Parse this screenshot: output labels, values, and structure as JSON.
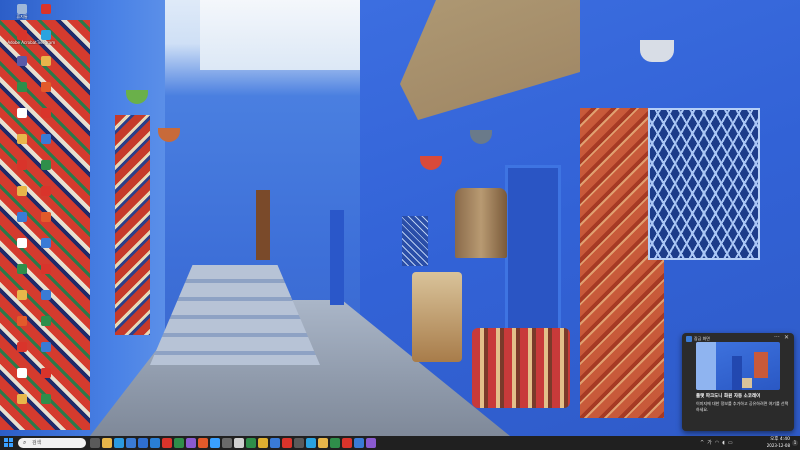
{
  "desktop": {
    "icons": [
      {
        "label": "휴지통",
        "icon": "recycle-bin-icon",
        "color": "#9fb7d8"
      },
      {
        "label": "",
        "icon": "app-icon",
        "color": "#d9342b"
      },
      {
        "label": "Adobe Acrobat",
        "icon": "acrobat-icon",
        "color": "#d9342b"
      },
      {
        "label": "Telegram",
        "icon": "telegram-icon",
        "color": "#2aa3e0"
      },
      {
        "label": "",
        "icon": "app-icon",
        "color": "#5a5aa8"
      },
      {
        "label": "",
        "icon": "folder-icon",
        "color": "#e8b64a"
      },
      {
        "label": "",
        "icon": "app-icon",
        "color": "#2f8e4a"
      },
      {
        "label": "",
        "icon": "app-icon",
        "color": "#e25a2a"
      },
      {
        "label": "",
        "icon": "app-icon",
        "color": "#ffffff"
      },
      {
        "label": "",
        "icon": "app-icon",
        "color": "#d9342b"
      },
      {
        "label": "",
        "icon": "folder-icon",
        "color": "#e8b64a"
      },
      {
        "label": "",
        "icon": "app-icon",
        "color": "#3a7bd5"
      },
      {
        "label": "",
        "icon": "app-icon",
        "color": "#d9342b"
      },
      {
        "label": "",
        "icon": "app-icon",
        "color": "#2f8e4a"
      },
      {
        "label": "",
        "icon": "folder-icon",
        "color": "#e8b64a"
      },
      {
        "label": "",
        "icon": "app-icon",
        "color": "#d9342b"
      },
      {
        "label": "",
        "icon": "app-icon",
        "color": "#3a7bd5"
      },
      {
        "label": "",
        "icon": "app-icon",
        "color": "#e25a2a"
      },
      {
        "label": "",
        "icon": "app-icon",
        "color": "#ffffff"
      },
      {
        "label": "",
        "icon": "app-icon",
        "color": "#3a7bd5"
      },
      {
        "label": "",
        "icon": "app-icon",
        "color": "#2f8e4a"
      },
      {
        "label": "",
        "icon": "app-icon",
        "color": "#d9342b"
      },
      {
        "label": "",
        "icon": "folder-icon",
        "color": "#e8b64a"
      },
      {
        "label": "",
        "icon": "app-icon",
        "color": "#3a7bd5"
      },
      {
        "label": "",
        "icon": "app-icon",
        "color": "#e25a2a"
      },
      {
        "label": "",
        "icon": "app-icon",
        "color": "#2f8e4a"
      },
      {
        "label": "",
        "icon": "app-icon",
        "color": "#d9342b"
      },
      {
        "label": "",
        "icon": "app-icon",
        "color": "#3a7bd5"
      },
      {
        "label": "",
        "icon": "app-icon",
        "color": "#ffffff"
      },
      {
        "label": "",
        "icon": "app-icon",
        "color": "#d9342b"
      },
      {
        "label": "",
        "icon": "folder-icon",
        "color": "#e8b64a"
      },
      {
        "label": "",
        "icon": "app-icon",
        "color": "#2f8e4a"
      }
    ]
  },
  "toast": {
    "app_name": "잠금 화면",
    "more_glyph": "···",
    "close_glyph": "✕",
    "title": "플랫 파크도니 화원 자동 소코레이",
    "body": "이미지에 대한 정보를 추가하고 공유하려면 여기를 선택하세요."
  },
  "taskbar": {
    "search_placeholder": "검색",
    "search_glyph": "⌕",
    "apps": [
      {
        "icon": "task-view-icon",
        "color": "#5a5a5a"
      },
      {
        "icon": "file-explorer-icon",
        "color": "#e8b64a"
      },
      {
        "icon": "edge-icon",
        "color": "#2b9ae0"
      },
      {
        "icon": "store-icon",
        "color": "#3a7bd5"
      },
      {
        "icon": "mail-icon",
        "color": "#2f6fd0"
      },
      {
        "icon": "vscode-icon",
        "color": "#2a7fd4"
      },
      {
        "icon": "app-icon",
        "color": "#d9342b"
      },
      {
        "icon": "app-icon",
        "color": "#2f8e4a"
      },
      {
        "icon": "app-icon",
        "color": "#8a5ad0"
      },
      {
        "icon": "app-icon",
        "color": "#e25a2a"
      },
      {
        "icon": "app-icon",
        "color": "#3aa0ff"
      },
      {
        "icon": "app-icon",
        "color": "#6a6a6a"
      },
      {
        "icon": "app-icon",
        "color": "#d0d0d0"
      },
      {
        "icon": "app-icon",
        "color": "#2f8e4a"
      },
      {
        "icon": "chrome-icon",
        "color": "#e0b030"
      },
      {
        "icon": "app-icon",
        "color": "#3a7bd5"
      },
      {
        "icon": "app-icon",
        "color": "#d9342b"
      },
      {
        "icon": "app-icon",
        "color": "#5a5a5a"
      },
      {
        "icon": "app-icon",
        "color": "#2aa3e0"
      },
      {
        "icon": "app-icon",
        "color": "#e8b64a"
      },
      {
        "icon": "app-icon",
        "color": "#2f8e4a"
      },
      {
        "icon": "app-icon",
        "color": "#d9342b"
      },
      {
        "icon": "app-icon",
        "color": "#3a7bd5"
      },
      {
        "icon": "app-icon",
        "color": "#8a5ad0"
      }
    ],
    "tray": {
      "chevron": "^",
      "lang": "가",
      "wifi": "◠",
      "volume": "◖",
      "battery": "▭"
    },
    "clock": {
      "time": "오후 4:40",
      "date": "2023-12-08"
    },
    "notifications_badge": "1"
  }
}
